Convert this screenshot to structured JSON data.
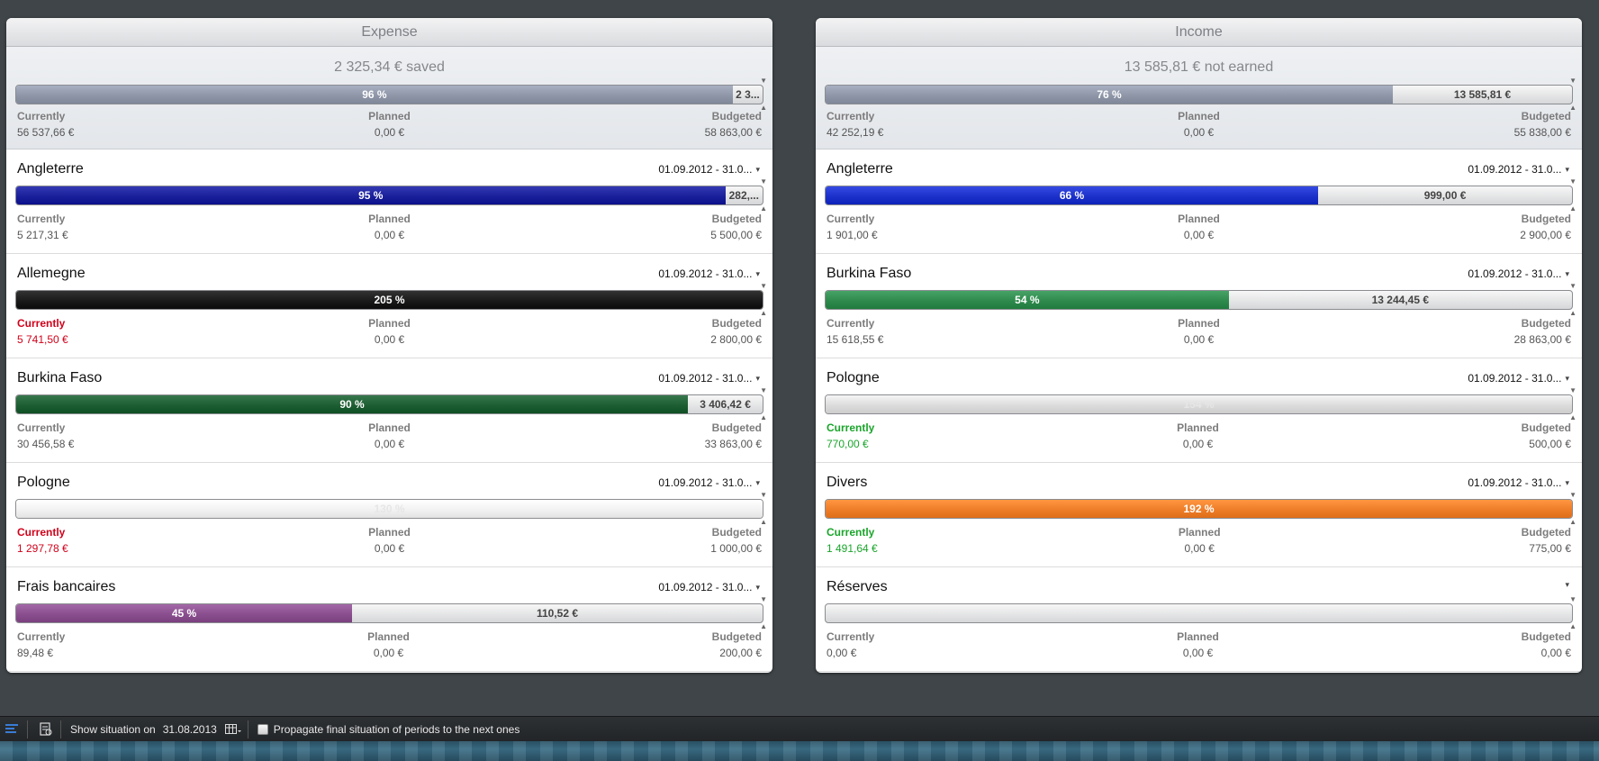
{
  "labels": {
    "currently": "Currently",
    "planned": "Planned",
    "budgeted": "Budgeted"
  },
  "expense": {
    "header": "Expense",
    "summary": {
      "title": "2 325,34 € saved",
      "percent": 96,
      "bar_text": "96 %",
      "rest_text": "2 3...",
      "currently": "56 537,66 €",
      "planned": "0,00 €",
      "budgeted": "58 863,00 €"
    },
    "rows": [
      {
        "name": "Angleterre",
        "period": "01.09.2012 - 31.0...",
        "percent": 95,
        "bar_text": "95 %",
        "rest_text": "282,...",
        "color": "#1a1f9a",
        "currently": "5 217,31 €",
        "planned": "0,00 €",
        "budgeted": "5 500,00 €",
        "status": "normal"
      },
      {
        "name": "Allemegne",
        "period": "01.09.2012 - 31.0...",
        "percent": 100,
        "bar_text": "205 %",
        "rest_text": "",
        "color": "#1a1a1a",
        "currently": "5 741,50 €",
        "planned": "0,00 €",
        "budgeted": "2 800,00 €",
        "status": "over"
      },
      {
        "name": "Burkina Faso",
        "period": "01.09.2012 - 31.0...",
        "percent": 90,
        "bar_text": "90 %",
        "rest_text": "3 406,42 €",
        "color": "#1e5e33",
        "currently": "30 456,58 €",
        "planned": "0,00 €",
        "budgeted": "33 863,00 €",
        "status": "normal"
      },
      {
        "name": "Pologne",
        "period": "01.09.2012 - 31.0...",
        "percent": 100,
        "bar_text": "130 %",
        "rest_text": "",
        "color": "#f2f2f2",
        "currently": "1 297,78 €",
        "planned": "0,00 €",
        "budgeted": "1 000,00 €",
        "status": "over"
      },
      {
        "name": "Frais bancaires",
        "period": "01.09.2012 - 31.0...",
        "percent": 45,
        "bar_text": "45 %",
        "rest_text": "110,52 €",
        "color": "#8a4f8e",
        "currently": "89,48 €",
        "planned": "0,00 €",
        "budgeted": "200,00 €",
        "status": "normal"
      }
    ]
  },
  "income": {
    "header": "Income",
    "summary": {
      "title": "13 585,81 € not earned",
      "percent": 76,
      "bar_text": "76 %",
      "rest_text": "13 585,81 €",
      "currently": "42 252,19 €",
      "planned": "0,00 €",
      "budgeted": "55 838,00 €"
    },
    "rows": [
      {
        "name": "Angleterre",
        "period": "01.09.2012 - 31.0...",
        "percent": 66,
        "bar_text": "66 %",
        "rest_text": "999,00 €",
        "color": "#1c31c9",
        "currently": "1 901,00 €",
        "planned": "0,00 €",
        "budgeted": "2 900,00 €",
        "status": "normal"
      },
      {
        "name": "Burkina Faso",
        "period": "01.09.2012 - 31.0...",
        "percent": 54,
        "bar_text": "54 %",
        "rest_text": "13 244,45 €",
        "color": "#2e8a4d",
        "currently": "15 618,55 €",
        "planned": "0,00 €",
        "budgeted": "28 863,00 €",
        "status": "normal"
      },
      {
        "name": "Pologne",
        "period": "01.09.2012 - 31.0...",
        "percent": 100,
        "bar_text": "154 %",
        "rest_text": "",
        "color": "#dcdcdc",
        "currently": "770,00 €",
        "planned": "0,00 €",
        "budgeted": "500,00 €",
        "status": "good"
      },
      {
        "name": "Divers",
        "period": "01.09.2012 - 31.0...",
        "percent": 100,
        "bar_text": "192 %",
        "rest_text": "",
        "color": "#ee7d28",
        "currently": "1 491,64 €",
        "planned": "0,00 €",
        "budgeted": "775,00 €",
        "status": "good"
      },
      {
        "name": "Réserves",
        "period": "",
        "percent": 0,
        "bar_text": "",
        "rest_text": "",
        "color": "#dcdcdc",
        "currently": "0,00 €",
        "planned": "0,00 €",
        "budgeted": "0,00 €",
        "status": "normal"
      }
    ]
  },
  "statusbar": {
    "show_label": "Show situation on",
    "date": "31.08.2013",
    "propagate_label": "Propagate final situation of periods to the next ones"
  },
  "colors": {
    "summary_bar": "#8e96a8",
    "over_text": "#d0021b",
    "good_text": "#1aa52b"
  }
}
